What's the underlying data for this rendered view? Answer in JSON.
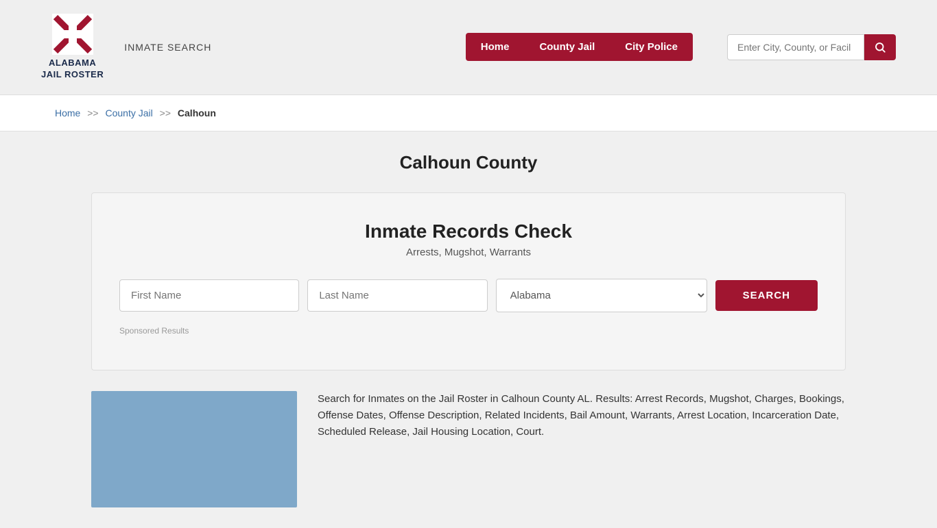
{
  "header": {
    "logo_line1": "ALABAMA",
    "logo_line2": "JAIL ROSTER",
    "inmate_search_label": "INMATE SEARCH",
    "nav": {
      "home": "Home",
      "county_jail": "County Jail",
      "city_police": "City Police"
    },
    "search_placeholder": "Enter City, County, or Facil"
  },
  "breadcrumb": {
    "home": "Home",
    "sep1": ">>",
    "county_jail": "County Jail",
    "sep2": ">>",
    "current": "Calhoun"
  },
  "page_title": "Calhoun County",
  "records_box": {
    "title": "Inmate Records Check",
    "subtitle": "Arrests, Mugshot, Warrants",
    "first_name_placeholder": "First Name",
    "last_name_placeholder": "Last Name",
    "state_default": "Alabama",
    "search_btn": "SEARCH",
    "sponsored_label": "Sponsored Results"
  },
  "description": "Search for Inmates on the Jail Roster in Calhoun County AL. Results: Arrest Records, Mugshot, Charges, Bookings, Offense Dates, Offense Description, Related Incidents, Bail Amount, Warrants, Arrest Location, Incarceration Date, Scheduled Release, Jail Housing Location, Court."
}
